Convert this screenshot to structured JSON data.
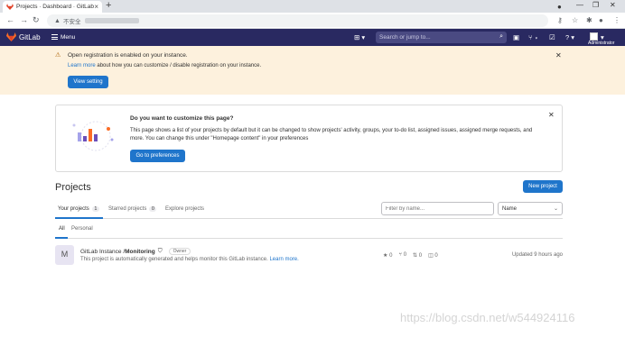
{
  "browser": {
    "tab_title": "Projects · Dashboard · GitLab",
    "tab_close": "×",
    "new_tab": "+",
    "security_label": "不安全",
    "window_controls": [
      "—",
      "❐",
      "✕"
    ]
  },
  "nav": {
    "brand": "GitLab",
    "menu_label": "Menu",
    "search_placeholder": "Search or jump to...",
    "user_label": "Administrator"
  },
  "alert": {
    "title": "Open registration is enabled on your instance.",
    "link_text": "Learn more",
    "body_text": " about how you can customize / disable registration on your instance.",
    "button_label": "View setting"
  },
  "customize_card": {
    "title": "Do you want to customize this page?",
    "body": "This page shows a list of your projects by default but it can be changed to show projects' activity, groups, your to-do list, assigned issues, assigned merge requests, and more. You can change this under \"Homepage content\" in your preferences",
    "button_label": "Go to preferences"
  },
  "projects": {
    "title": "Projects",
    "new_button": "New project",
    "tabs": [
      {
        "label": "Your projects",
        "count": "1"
      },
      {
        "label": "Starred projects",
        "count": "0"
      },
      {
        "label": "Explore projects",
        "count": ""
      }
    ],
    "filter_placeholder": "Filter by name...",
    "sort_label": "Name",
    "subtabs": [
      "All",
      "Personal"
    ],
    "list": [
      {
        "avatar_letter": "M",
        "namespace": "GitLab Instance / ",
        "name": "Monitoring",
        "role": "Owner",
        "description": "This project is automatically generated and helps monitor this GitLab instance. ",
        "description_link": "Learn more.",
        "stars": "0",
        "forks": "0",
        "merge_requests": "0",
        "issues": "0",
        "updated": "Updated 9 hours ago"
      }
    ]
  },
  "watermark": "https://blog.csdn.net/w544924116",
  "colors": {
    "nav_bg": "#292961",
    "primary": "#1f75cb",
    "alert_bg": "#fdf1dd"
  }
}
